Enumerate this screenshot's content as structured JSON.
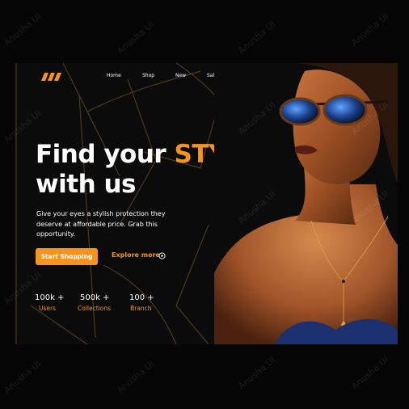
{
  "brand": {
    "accent_color": "#f7941d",
    "logo_icon": "three-slashes-logo"
  },
  "nav": {
    "items": [
      "Home",
      "Shop",
      "New",
      "Sale"
    ]
  },
  "hero": {
    "title_line1": "Find your",
    "title_highlight": "STYLE",
    "title_line2": "with us",
    "subtitle": "Give your eyes a stylish protection they deserve at affordable price. Grab this opportunity.",
    "primary_button": "Start Shopping",
    "secondary_link": "Explore more",
    "secondary_icon": "circle-arrow-icon"
  },
  "stats": [
    {
      "value": "100k +",
      "label": "Users"
    },
    {
      "value": "500k +",
      "label": "Collections"
    },
    {
      "value": "100 +",
      "label": "Branch"
    }
  ],
  "watermark": "Anusha UI"
}
